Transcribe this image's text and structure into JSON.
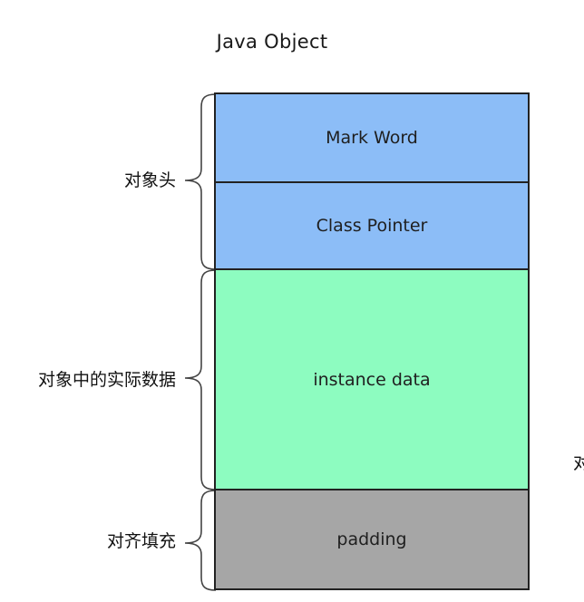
{
  "title": "Java Object",
  "blocks": [
    {
      "id": "mark-word",
      "label": "Mark Word",
      "color": "#8cbdf7"
    },
    {
      "id": "class-pointer",
      "label": "Class Pointer",
      "color": "#8cbdf7"
    },
    {
      "id": "instance-data",
      "label": "instance data",
      "color": "#8dfcc0"
    },
    {
      "id": "padding",
      "label": "padding",
      "color": "#a6a6a6"
    }
  ],
  "braces": [
    {
      "label": "对象头"
    },
    {
      "label": "对象中的实际数据"
    },
    {
      "label": "对齐填充"
    }
  ],
  "edge_text": "对"
}
